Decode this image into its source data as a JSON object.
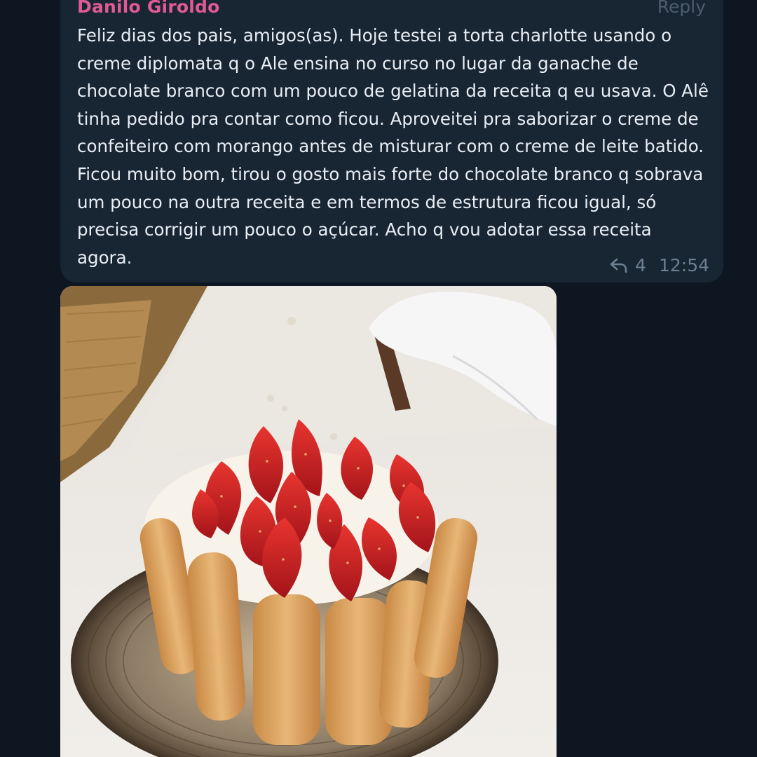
{
  "message": {
    "sender": "Danilo Giroldo",
    "reply_label": "Reply",
    "text": "Feliz dias dos pais, amigos(as). Hoje testei a torta charlotte usando o creme diplomata q o Ale ensina no curso no lugar da ganache de chocolate branco com um pouco de gelatina da receita q eu usava. O Alê tinha pedido pra contar como ficou. Aproveitei pra saborizar o creme de confeiteiro com morango antes de misturar com o creme de leite batido. Ficou muito bom, tirou o gosto mais forte do chocolate branco q sobrava um pouco na outra receita e em termos de estrutura ficou igual, só precisa corrigir um pouco o açúcar. Acho q vou adotar essa receita agora.",
    "reply_count": "4",
    "time": "12:54"
  },
  "colors": {
    "background": "#0e1621",
    "bubble": "#182533",
    "sender": "#e05a94",
    "meta": "#6c7f92"
  },
  "icons": {
    "reply": "reply-arrow-icon"
  },
  "photo": {
    "subject": "charlotte-cake-with-strawberries"
  }
}
